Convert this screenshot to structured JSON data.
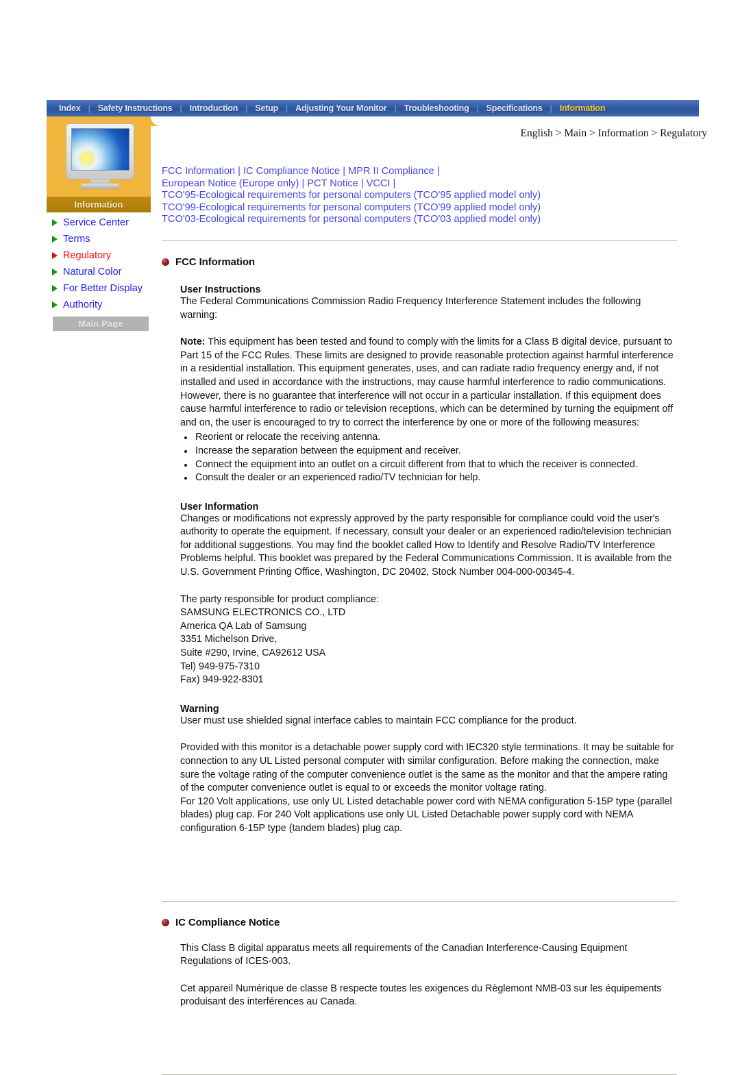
{
  "topnav": {
    "items": [
      {
        "label": "Index",
        "active": false
      },
      {
        "label": "Safety Instructions",
        "active": false
      },
      {
        "label": "Introduction",
        "active": false
      },
      {
        "label": "Setup",
        "active": false
      },
      {
        "label": "Adjusting Your Monitor",
        "active": false
      },
      {
        "label": "Troubleshooting",
        "active": false
      },
      {
        "label": "Specifications",
        "active": false
      },
      {
        "label": "Information",
        "active": true
      }
    ],
    "separator": "|"
  },
  "sidebar": {
    "section_tab_label": "Information",
    "monitor_icon": "crt-monitor-icon",
    "items": [
      {
        "label": "Service Center",
        "current": false
      },
      {
        "label": "Terms",
        "current": false
      },
      {
        "label": "Regulatory",
        "current": true
      },
      {
        "label": "Natural Color",
        "current": false
      },
      {
        "label": "For Better Display",
        "current": false
      },
      {
        "label": "Authority",
        "current": false
      }
    ],
    "main_page_button": "Main Page"
  },
  "breadcrumb": "English > Main > Information > Regulatory",
  "quicklinks": {
    "line1": [
      {
        "text": "FCC Information"
      },
      {
        "text": "IC Compliance Notice"
      },
      {
        "text": "MPR II Compliance"
      }
    ],
    "line1_trailing_pipe": "|",
    "line2": [
      {
        "text": "European Notice (Europe only)"
      },
      {
        "text": "PCT Notice"
      },
      {
        "text": "VCCI"
      }
    ],
    "line2_trailing_pipe": "|",
    "line3": "TCO'95-Ecological requirements for personal computers (TCO'95 applied model only)",
    "line4": "TCO'99-Ecological requirements for personal computers (TCO'99 applied model only)",
    "line5": "TCO'03-Ecological requirements for personal computers (TCO'03 applied model only)",
    "separator": "|"
  },
  "fcc": {
    "heading": "FCC Information",
    "bullet_icon": "red-sphere-bullet-icon",
    "user_instructions_head": "User Instructions",
    "user_instructions_text": "The Federal Communications Commission Radio Frequency Interference Statement includes the following warning:",
    "note_label": "Note:",
    "note_text": " This equipment has been tested and found to comply with the limits for a Class B digital device, pursuant to Part 15 of the FCC Rules. These limits are designed to provide reasonable protection against harmful interference in a residential installation. This equipment generates, uses, and can radiate radio frequency energy and, if not installed and used in accordance with the instructions, may cause harmful interference to radio communications. However, there is no guarantee that interference will not occur in a particular installation. If this equipment does cause harmful interference to radio or television receptions, which can be determined by turning the equipment off and on, the user is encouraged to try to correct the interference by one or more of the following measures:",
    "measures": [
      "Reorient or relocate the receiving antenna.",
      "Increase the separation between the equipment and receiver.",
      "Connect the equipment into an outlet on a circuit different from that to which the receiver is connected.",
      "Consult the dealer or an experienced radio/TV technician for help."
    ],
    "user_information_head": "User Information",
    "user_information_text": "Changes or modifications not expressly approved by the party responsible for compliance could void the user's authority to operate the equipment. If necessary, consult your dealer or an experienced radio/television technician for additional suggestions. You may find the booklet called How to Identify and Resolve Radio/TV Interference Problems helpful. This booklet was prepared by the Federal Communications Commission. It is available from the U.S. Government Printing Office, Washington, DC 20402, Stock Number 004-000-00345-4.",
    "responsible_party": [
      "The party responsible for product compliance:",
      "SAMSUNG ELECTRONICS CO., LTD",
      "America QA Lab of Samsung",
      "3351 Michelson Drive,",
      "Suite #290, Irvine, CA92612 USA",
      "Tel) 949-975-7310",
      "Fax) 949-922-8301"
    ],
    "warning_head": "Warning",
    "warning_text": "User must use shielded signal interface cables to maintain FCC compliance for the product.",
    "cord_text": "Provided with this monitor is a detachable power supply cord with IEC320 style terminations. It may be suitable for connection to any UL Listed personal computer with similar configuration. Before making the connection, make sure the voltage rating of the computer convenience outlet is the same as the monitor and that the ampere rating of the computer convenience outlet is equal to or exceeds the monitor voltage rating.",
    "nema_text": "For 120 Volt applications, use only UL Listed detachable power cord with NEMA configuration 5-15P type (parallel blades) plug cap. For 240 Volt applications use only UL Listed Detachable power supply cord with NEMA configuration 6-15P type (tandem blades) plug cap."
  },
  "ic": {
    "heading": "IC Compliance Notice",
    "bullet_icon": "red-sphere-bullet-icon",
    "para_en": "This Class B digital apparatus meets all requirements of the Canadian Interference-Causing Equipment Regulations of ICES-003.",
    "para_fr": "Cet appareil Numérique de classe B respecte toutes les exigences du Règlemont NMB-03 sur les équipements produisant des interférences au Canada."
  },
  "colors": {
    "nav_bar_blue": "#2f5ba6",
    "nav_active_gold": "#ffc233",
    "sidebar_orange": "#f1b53e",
    "section_tab_brown": "#b8860b",
    "link_blue": "#4646e6",
    "current_red": "#ee1111",
    "arrow_green": "#109410",
    "bullet_maroon": "#9e1f28",
    "rule_gray": "#b6b6b0"
  }
}
